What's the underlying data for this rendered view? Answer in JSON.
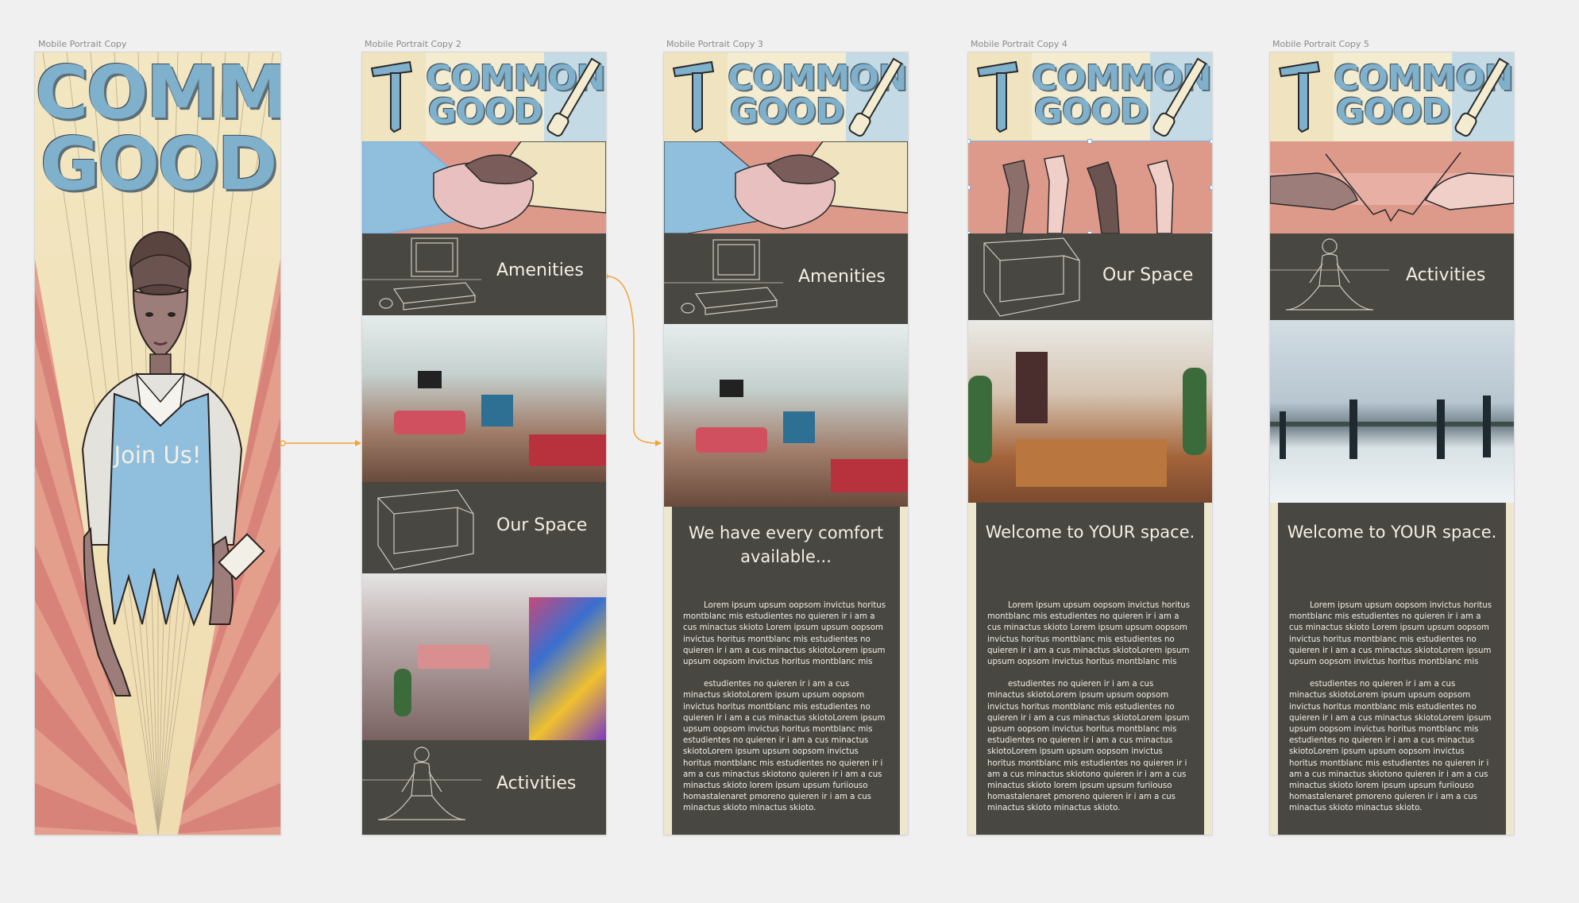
{
  "artboards": [
    {
      "name": "Mobile Portrait Copy"
    },
    {
      "name": "Mobile Portrait Copy 2"
    },
    {
      "name": "Mobile Portrait Copy 3"
    },
    {
      "name": "Mobile Portrait Copy 4"
    },
    {
      "name": "Mobile Portrait Copy 5"
    }
  ],
  "brand": {
    "line1": "COMMON",
    "line2": "GOOD"
  },
  "splash": {
    "cta": "Join Us!"
  },
  "sections": {
    "amenities": "Amenities",
    "our_space": "Our Space",
    "activities": "Activities"
  },
  "copy3": {
    "heading": "We have every comfort available..."
  },
  "copy4": {
    "heading": "Welcome to YOUR space."
  },
  "copy5": {
    "heading": "Welcome to YOUR space."
  },
  "lorem": {
    "p1": "Lorem ipsum upsum oopsom invictus horitus montblanc mis estudientes no quieren ir i am a cus minactus skioto Lorem ipsum upsum oopsom invictus horitus montblanc mis estudientes no quieren ir i am a cus minactus skiotoLorem ipsum upsum oopsom invictus horitus montblanc mis",
    "p2": "estudientes no quieren ir i am a cus minactus skiotoLorem ipsum upsum oopsom invictus horitus montblanc mis estudientes no quieren ir i am a cus minactus skiotoLorem ipsum upsum oopsom invictus horitus montblanc mis estudientes no quieren ir i am a cus minactus skiotoLorem ipsum upsum oopsom invictus horitus montblanc mis estudientes no quieren ir i am a cus minactus skiotono quieren ir i am a cus minactus skioto lorem ipsum upsum furiiouso homastalenaret pmoreno quieren ir i am a cus minactus skioto minactus skioto."
  },
  "colors": {
    "canvas": "#f0f0f0",
    "cream": "#f4ecd0",
    "sky": "#c4dbe6",
    "salmon": "#dd9a8a",
    "dark_panel": "#494741",
    "logo_blue": "#7fb0cc",
    "prototype_link": "#f0a33a",
    "selection": "#7fb0e0"
  }
}
